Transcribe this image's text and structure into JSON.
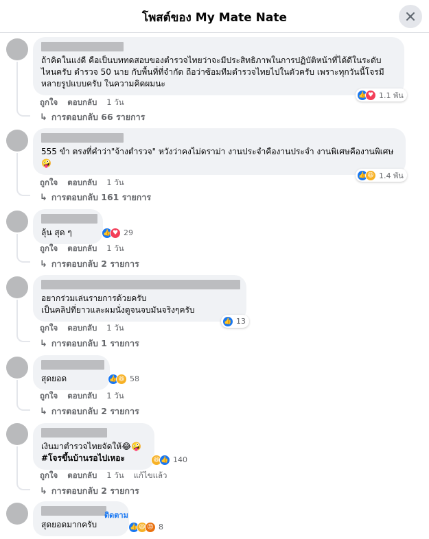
{
  "header": {
    "title": "โพสต์ของ My Mate Nate",
    "close_icon": "close-icon"
  },
  "actions": {
    "like": "ถูกใจ",
    "reply": "ตอบกลับ"
  },
  "comments": [
    {
      "text": "ถ้าคิดในแง่ดี คือเป็นบททดสอบของตำรวจไทยว่าจะมีประสิทธิภาพในการปฏิบัติหน้าที่ได้ดีในระดับไหนครับ ตำรวจ 50 นาย กับพื้นที่ที่จำกัด ถือว่าซ้อมทีมตำรวจไทยไปในตัวครับ เพราะทุกวันนี้โจรมีหลายรูปแบบครับ ในความคิดผมนะ",
      "reactions": [
        "like",
        "love"
      ],
      "reaction_count": "1.1 พัน",
      "time": "1 วัน",
      "replies": "การตอบกลับ 66 รายการ"
    },
    {
      "text": "555 ขำ ตรงที่คำว่า\"จ้างตำรวจ\" หวังว่าคงไม่ดราม่า งานประจำคืองานประจำ งานพิเศษคืองานพิเศษ 🤪",
      "reactions": [
        "like",
        "haha"
      ],
      "reaction_count": "1.4 พัน",
      "time": "1 วัน",
      "replies": "การตอบกลับ 161 รายการ"
    },
    {
      "text": "ลุ้น สุด ๆ",
      "reactions": [
        "like",
        "love"
      ],
      "reaction_count": "29",
      "time": "1 วัน",
      "replies": "การตอบกลับ 2 รายการ"
    },
    {
      "text": "อยากร่วมเล่นรายการด้วยครับ\nเป็นคลิปที่ยาวและผมนั่งดูจนจบมันจริงๆครับ",
      "reactions": [
        "like"
      ],
      "reaction_count": "13",
      "time": "1 วัน",
      "replies": "การตอบกลับ 1 รายการ"
    },
    {
      "text": "สุดยอด",
      "reactions": [
        "like",
        "haha"
      ],
      "reaction_count": "58",
      "time": "1 วัน",
      "replies": "การตอบกลับ 2 รายการ"
    },
    {
      "text": "เงินมาตำรวจไทยจัดให้😂🤪",
      "hashtag": "#โจรขึ้นบ้านรอไปเหอะ",
      "reactions": [
        "haha",
        "like"
      ],
      "reaction_count": "140",
      "time": "1 วัน",
      "edited": "แก้ไขแล้ว",
      "replies": "การตอบกลับ 2 รายการ"
    },
    {
      "follow": "ติดตาม",
      "text": "สุดยอดมากครับ",
      "reactions": [
        "like",
        "haha",
        "angry"
      ],
      "reaction_count": "8"
    }
  ],
  "colors": {
    "like": "#1877f2",
    "love": "#f33e58",
    "haha": "#f7b125",
    "angry": "#e9710f",
    "link": "#1877f2"
  }
}
